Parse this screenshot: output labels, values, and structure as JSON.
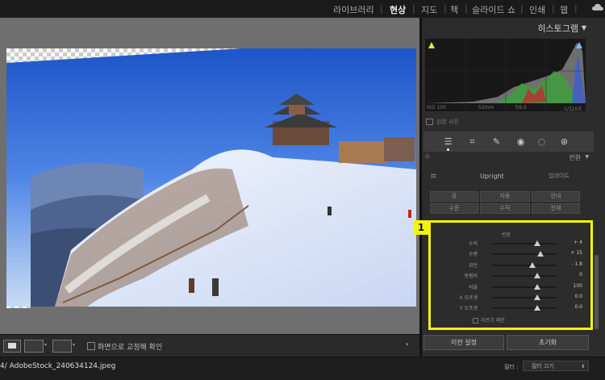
{
  "nav": {
    "modules": [
      "라이브러리",
      "현상",
      "지도",
      "책",
      "슬라이드 쇼",
      "인쇄",
      "웹"
    ],
    "active_module": "현상",
    "separator": "|",
    "cloud_icon": "cloud-icon"
  },
  "histogram": {
    "title": "히스토그램",
    "iso": "ISO 100",
    "focal": "52mm",
    "aperture": "f/9.0",
    "shutter": "1/320초",
    "original_photo_label": "원본 사진"
  },
  "tools": [
    "sliders-icon",
    "crop-icon",
    "eraser-icon",
    "redeye-icon",
    "mask-circle-icon",
    "settings-circle-icon"
  ],
  "lens_panel": {
    "title": "변환",
    "upright_label": "Upright",
    "upright_update": "업데이트",
    "buttons_row1": [
      "끔",
      "자동",
      "안내"
    ],
    "buttons_row2": [
      "수준",
      "수직",
      "전체"
    ]
  },
  "transform": {
    "badge": "1",
    "title": "변환",
    "sliders": [
      {
        "label": "수직",
        "value": "+ 4",
        "pos": 0.7
      },
      {
        "label": "수평",
        "value": "+ 15",
        "pos": 0.75
      },
      {
        "label": "회전",
        "value": "- 1.8",
        "pos": 0.62
      },
      {
        "label": "종횡비",
        "value": "0",
        "pos": 0.7
      },
      {
        "label": "비율",
        "value": "100",
        "pos": 0.7
      },
      {
        "label": "X 오프셋",
        "value": "0.0",
        "pos": 0.7
      },
      {
        "label": "Y 오프셋",
        "value": "0.0",
        "pos": 0.7
      }
    ],
    "constrain_crop_label": "자르기 제한"
  },
  "panel_buttons": {
    "previous": "이전 설정",
    "reset": "초기화"
  },
  "toolbar": {
    "show_grid_label": "화면으로 교정해 확인"
  },
  "filmstrip": {
    "filename": "4/ AdobeStock_240634124.jpeg",
    "filter_label": "필터 :",
    "filter_value": "필터 끄기"
  },
  "colors": {
    "highlight": "#f4f40a",
    "background": "#1b1b1b",
    "panel": "#2c2c2c"
  }
}
